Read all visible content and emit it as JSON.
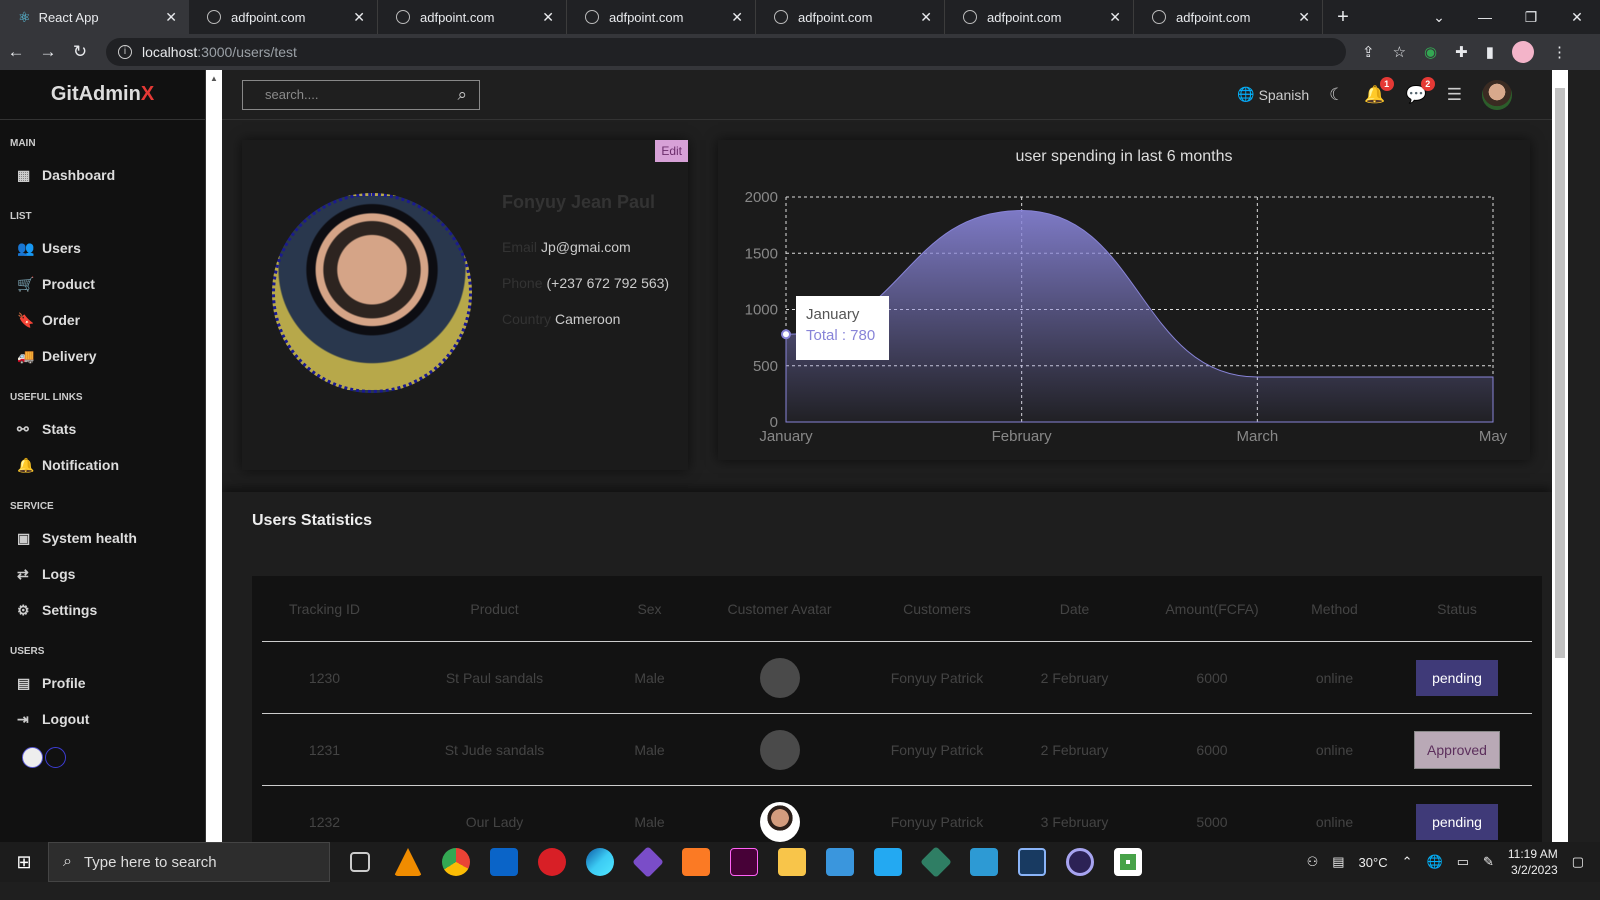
{
  "browser": {
    "tabs": [
      {
        "title": "React App",
        "active": true
      },
      {
        "title": "adfpoint.com"
      },
      {
        "title": "adfpoint.com"
      },
      {
        "title": "adfpoint.com"
      },
      {
        "title": "adfpoint.com"
      },
      {
        "title": "adfpoint.com"
      },
      {
        "title": "adfpoint.com"
      }
    ],
    "url_host": "localhost",
    "url_path": ":3000/users/test"
  },
  "sidebar": {
    "logo_main": "GitAdmin",
    "logo_accent": "X",
    "sections": [
      {
        "title": "MAIN",
        "items": [
          {
            "label": "Dashboard",
            "icon": "dashboard-icon"
          }
        ]
      },
      {
        "title": "LIST",
        "items": [
          {
            "label": "Users",
            "icon": "users-icon"
          },
          {
            "label": "Product",
            "icon": "cart-icon"
          },
          {
            "label": "Order",
            "icon": "bookmark-icon"
          },
          {
            "label": "Delivery",
            "icon": "truck-icon"
          }
        ]
      },
      {
        "title": "USEFUL LINKS",
        "items": [
          {
            "label": "Stats",
            "icon": "stats-icon"
          },
          {
            "label": "Notification",
            "icon": "bell-icon"
          }
        ]
      },
      {
        "title": "SERVICE",
        "items": [
          {
            "label": "System health",
            "icon": "health-icon"
          },
          {
            "label": "Logs",
            "icon": "logs-icon"
          },
          {
            "label": "Settings",
            "icon": "settings-icon"
          }
        ]
      },
      {
        "title": "USERS",
        "items": [
          {
            "label": "Profile",
            "icon": "profile-icon"
          },
          {
            "label": "Logout",
            "icon": "logout-icon"
          }
        ]
      }
    ]
  },
  "topbar": {
    "search_placeholder": "search....",
    "language": "Spanish",
    "notifications_count": "1",
    "messages_count": "2"
  },
  "user": {
    "edit_label": "Edit",
    "name": "Fonyuy Jean Paul",
    "email_label": "Email",
    "email": "Jp@gmai.com",
    "phone_label": "Phone",
    "phone": "(+237 672 792 563)",
    "country_label": "Country",
    "country": "Cameroon"
  },
  "chart_data": {
    "type": "area",
    "title": "user spending in last 6 months",
    "categories": [
      "January",
      "February",
      "March",
      "May"
    ],
    "series": [
      {
        "values": [
          780,
          1880,
          400,
          400
        ]
      }
    ],
    "ylim": [
      0,
      2000
    ],
    "yticks": [
      0,
      500,
      1000,
      1500,
      2000
    ],
    "grid": true,
    "color": "#8884d8",
    "tooltip": {
      "label": "January",
      "text": "Total : 780"
    }
  },
  "stats": {
    "title": "Users Statistics",
    "columns": [
      "Tracking ID",
      "Product",
      "Sex",
      "Customer Avatar",
      "Customers",
      "Date",
      "Amount(FCFA)",
      "Method",
      "Status"
    ],
    "rows": [
      {
        "id": "1230",
        "product": "St Paul sandals",
        "sex": "Male",
        "customer": "Fonyuy Patrick",
        "date": "2 February",
        "amount": "6000",
        "method": "online",
        "status": "pending"
      },
      {
        "id": "1231",
        "product": "St Jude sandals",
        "sex": "Male",
        "customer": "Fonyuy Patrick",
        "date": "2 February",
        "amount": "6000",
        "method": "online",
        "status": "Approved"
      },
      {
        "id": "1232",
        "product": "Our Lady",
        "sex": "Male",
        "customer": "Fonyuy Patrick",
        "date": "3 February",
        "amount": "5000",
        "method": "online",
        "status": "pending"
      }
    ]
  },
  "taskbar": {
    "search_placeholder": "Type here to search",
    "temperature": "30°C",
    "time": "11:19 AM",
    "date": "3/2/2023"
  }
}
